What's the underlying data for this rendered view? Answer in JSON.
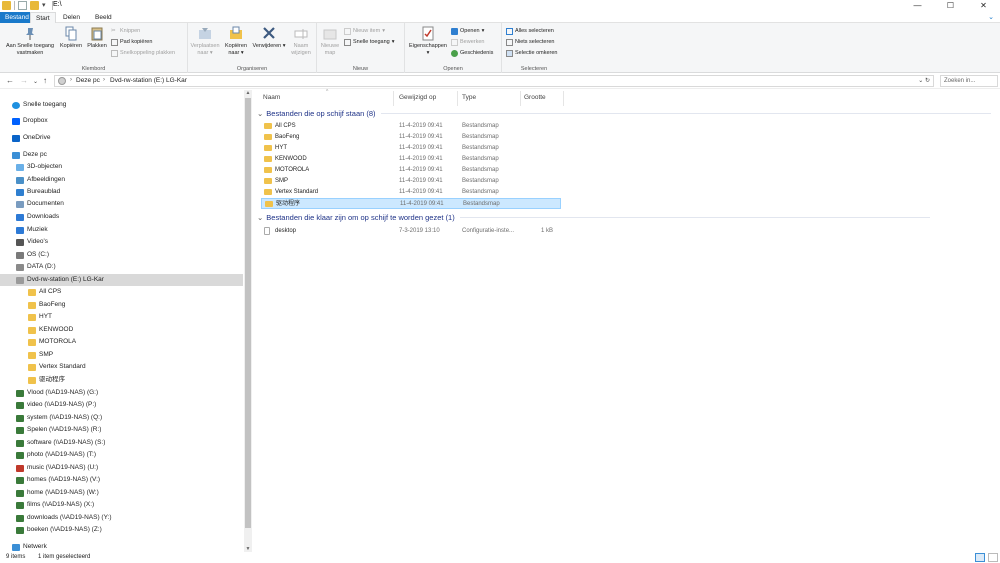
{
  "title": {
    "path": "E:\\"
  },
  "window_controls": [
    "—",
    "☐",
    "✕"
  ],
  "tabs": {
    "file": "Bestand",
    "start": "Start",
    "share": "Delen",
    "view": "Beeld"
  },
  "ribbon": {
    "pin": "Aan Snelle toegang vastmaken",
    "copy": "Kopiëren",
    "paste": "Plakken",
    "cut": "Knippen",
    "copy_path": "Pad kopiëren",
    "paste_shortcut": "Snelkoppeling plakken",
    "move_to": "Verplaatsen naar",
    "copy_to": "Kopiëren naar",
    "delete": "Verwijderen",
    "rename": "Naam wijzigen",
    "new_folder": "Nieuwe map",
    "new_item": "Nieuw item",
    "easy_access": "Snelle toegang",
    "properties": "Eigenschappen",
    "open": "Openen",
    "edit": "Bewerken",
    "history": "Geschiedenis",
    "select_all": "Alles selecteren",
    "select_none": "Niets selecteren",
    "invert_selection": "Selectie omkeren",
    "group_clipboard": "Klembord",
    "group_organize": "Organiseren",
    "group_new": "Nieuw",
    "group_open": "Openen",
    "group_select": "Selecteren"
  },
  "address": {
    "crumbs": [
      "Deze pc",
      "Dvd-rw-station (E:) LG-Kar"
    ],
    "search_placeholder": "Zoeken in..."
  },
  "nav": {
    "items": [
      {
        "label": "Snelle toegang",
        "icon": "star-icon",
        "color": "#1e90e0",
        "indent": 0
      },
      {
        "label": "Dropbox",
        "icon": "dropbox-icon",
        "color": "#0061fe",
        "indent": 0
      },
      {
        "label": "OneDrive",
        "icon": "cloud-icon",
        "color": "#0a64c8",
        "indent": 0
      },
      {
        "label": "Deze pc",
        "icon": "computer-icon",
        "color": "#3b8fd6",
        "indent": 0
      },
      {
        "label": "3D-objecten",
        "icon": "cube-icon",
        "color": "#6ab0e8",
        "indent": 1
      },
      {
        "label": "Afbeeldingen",
        "icon": "pictures-icon",
        "color": "#4a90c8",
        "indent": 1
      },
      {
        "label": "Bureaublad",
        "icon": "desktop-icon",
        "color": "#2f7fd0",
        "indent": 1
      },
      {
        "label": "Documenten",
        "icon": "documents-icon",
        "color": "#7a9cc0",
        "indent": 1
      },
      {
        "label": "Downloads",
        "icon": "download-icon",
        "color": "#2d7ad6",
        "indent": 1
      },
      {
        "label": "Muziek",
        "icon": "music-icon",
        "color": "#2d7ad6",
        "indent": 1
      },
      {
        "label": "Video's",
        "icon": "video-icon",
        "color": "#555555",
        "indent": 1
      },
      {
        "label": "OS (C:)",
        "icon": "drive-icon",
        "color": "#7a7a7a",
        "indent": 1
      },
      {
        "label": "DATA (D:)",
        "icon": "drive-icon",
        "color": "#8a8a8a",
        "indent": 1
      },
      {
        "label": "Dvd-rw-station (E:) LG-Kar",
        "icon": "dvd-icon",
        "color": "#9a9a9a",
        "indent": 1,
        "selected": true
      },
      {
        "label": "All CPS",
        "icon": "folder-icon",
        "color": "#f0c24b",
        "indent": 2
      },
      {
        "label": "BaoFeng",
        "icon": "folder-icon",
        "color": "#f0c24b",
        "indent": 2
      },
      {
        "label": "HYT",
        "icon": "folder-icon",
        "color": "#f0c24b",
        "indent": 2
      },
      {
        "label": "KENWOOD",
        "icon": "folder-icon",
        "color": "#f0c24b",
        "indent": 2
      },
      {
        "label": "MOTOROLA",
        "icon": "folder-icon",
        "color": "#f0c24b",
        "indent": 2
      },
      {
        "label": "SMP",
        "icon": "folder-icon",
        "color": "#f0c24b",
        "indent": 2
      },
      {
        "label": "Vertex Standard",
        "icon": "folder-icon",
        "color": "#f0c24b",
        "indent": 2
      },
      {
        "label": "驱动程序",
        "icon": "folder-icon",
        "color": "#f0c24b",
        "indent": 2
      },
      {
        "label": "Vlood (\\\\AD19-NAS) (G:)",
        "icon": "network-drive-icon",
        "color": "#3a7a3a",
        "indent": 1
      },
      {
        "label": "video (\\\\AD19-NAS) (P:)",
        "icon": "network-drive-icon",
        "color": "#3a7a3a",
        "indent": 1
      },
      {
        "label": "system (\\\\AD19-NAS) (Q:)",
        "icon": "network-drive-icon",
        "color": "#3a7a3a",
        "indent": 1
      },
      {
        "label": "Spelen (\\\\AD19-NAS) (R:)",
        "icon": "network-drive-icon",
        "color": "#3a7a3a",
        "indent": 1
      },
      {
        "label": "software (\\\\AD19-NAS) (S:)",
        "icon": "network-drive-icon",
        "color": "#3a7a3a",
        "indent": 1
      },
      {
        "label": "photo (\\\\AD19-NAS) (T:)",
        "icon": "network-drive-icon",
        "color": "#3a7a3a",
        "indent": 1
      },
      {
        "label": "music (\\\\AD19-NAS) (U:)",
        "icon": "network-drive-disconnected-icon",
        "color": "#c0392b",
        "indent": 1
      },
      {
        "label": "homes (\\\\AD19-NAS) (V:)",
        "icon": "network-drive-icon",
        "color": "#3a7a3a",
        "indent": 1
      },
      {
        "label": "home (\\\\AD19-NAS) (W:)",
        "icon": "network-drive-icon",
        "color": "#3a7a3a",
        "indent": 1
      },
      {
        "label": "films (\\\\AD19-NAS) (X:)",
        "icon": "network-drive-icon",
        "color": "#3a7a3a",
        "indent": 1
      },
      {
        "label": "downloads (\\\\AD19-NAS) (Y:)",
        "icon": "network-drive-icon",
        "color": "#3a7a3a",
        "indent": 1
      },
      {
        "label": "boeken (\\\\AD19-NAS) (Z:)",
        "icon": "network-drive-icon",
        "color": "#3a7a3a",
        "indent": 1
      },
      {
        "label": "Netwerk",
        "icon": "network-icon",
        "color": "#3b8fd6",
        "indent": 0
      }
    ]
  },
  "columns": {
    "name": "Naam",
    "modified": "Gewijzigd op",
    "type": "Type",
    "size": "Grootte"
  },
  "groups": [
    {
      "title": "Bestanden die op schijf staan (8)",
      "files": [
        {
          "name": "All CPS",
          "date": "11-4-2019 09:41",
          "type": "Bestandsmap",
          "size": "",
          "icon": "folder-icon"
        },
        {
          "name": "BaoFeng",
          "date": "11-4-2019 09:41",
          "type": "Bestandsmap",
          "size": "",
          "icon": "folder-icon"
        },
        {
          "name": "HYT",
          "date": "11-4-2019 09:41",
          "type": "Bestandsmap",
          "size": "",
          "icon": "folder-icon"
        },
        {
          "name": "KENWOOD",
          "date": "11-4-2019 09:41",
          "type": "Bestandsmap",
          "size": "",
          "icon": "folder-icon"
        },
        {
          "name": "MOTOROLA",
          "date": "11-4-2019 09:41",
          "type": "Bestandsmap",
          "size": "",
          "icon": "folder-icon"
        },
        {
          "name": "SMP",
          "date": "11-4-2019 09:41",
          "type": "Bestandsmap",
          "size": "",
          "icon": "folder-icon"
        },
        {
          "name": "Vertex Standard",
          "date": "11-4-2019 09:41",
          "type": "Bestandsmap",
          "size": "",
          "icon": "folder-icon"
        },
        {
          "name": "驱动程序",
          "date": "11-4-2019 09:41",
          "type": "Bestandsmap",
          "size": "",
          "icon": "folder-icon",
          "selected": true
        }
      ]
    },
    {
      "title": "Bestanden die klaar zijn om op schijf te worden gezet (1)",
      "files": [
        {
          "name": "desktop",
          "date": "7-3-2019 13:10",
          "type": "Configuratie-inste...",
          "size": "1 kB",
          "icon": "config-file-icon"
        }
      ]
    }
  ],
  "status": {
    "items": "9 items",
    "selected": "1 item geselecteerd"
  }
}
